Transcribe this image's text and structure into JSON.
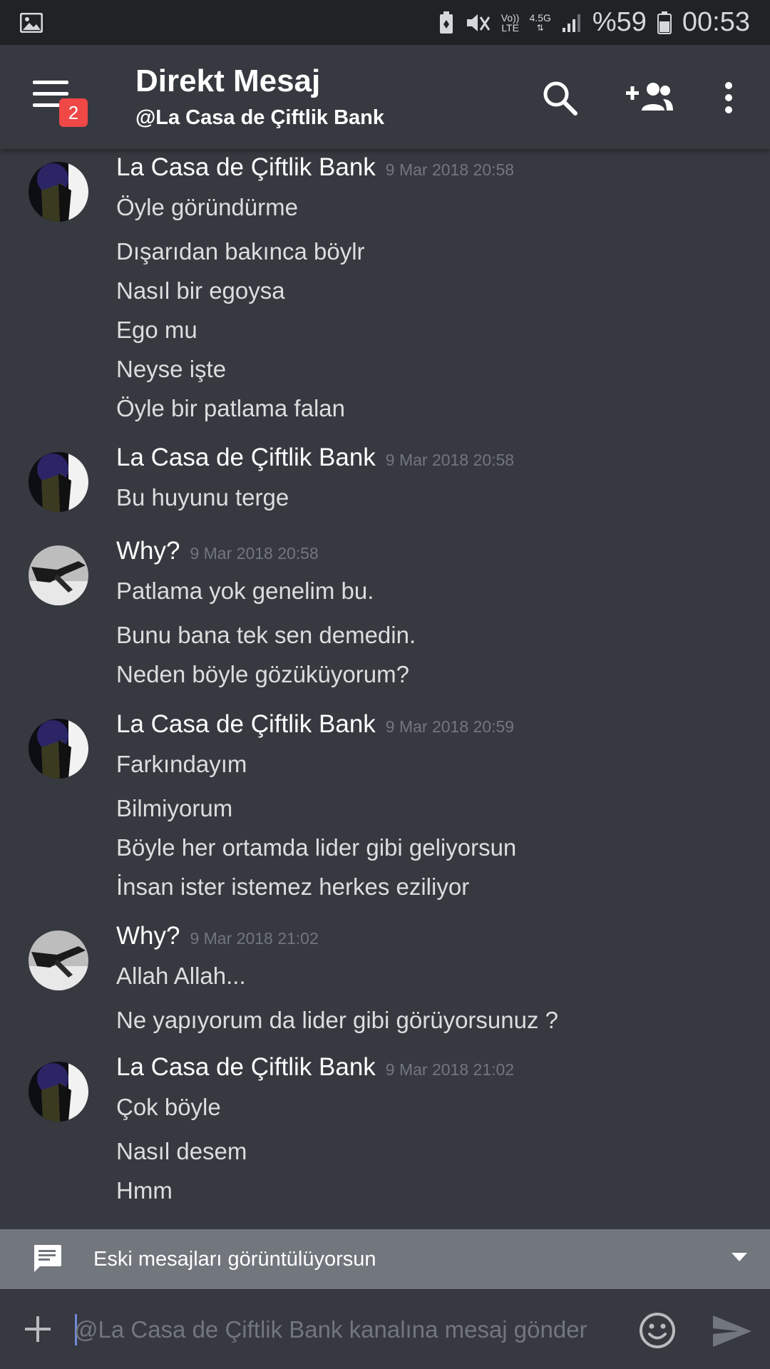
{
  "statusbar": {
    "network_top": "Vo))",
    "network_bottom": "LTE",
    "network_gen": "4.5G",
    "battery": "%59",
    "time": "00:53",
    "icons": [
      "gallery-icon",
      "battery-saver-icon",
      "mute-icon",
      "signal-icon",
      "battery-icon"
    ]
  },
  "header": {
    "title": "Direkt Mesaj",
    "subtitle": "@La Casa de Çiftlik Bank",
    "badge": "2",
    "icons": [
      "hamburger-menu-icon",
      "search-icon",
      "add-friend-icon",
      "more-vertical-icon"
    ]
  },
  "messages": [
    {
      "author": "La Casa de Çiftlik Bank",
      "timestamp": "9 Mar 2018 20:58",
      "avatar": "dark-purple",
      "lines": [
        "Öyle göründürme",
        "Dışarıdan bakınca böylr",
        "Nasıl bir egoysa",
        "Ego mu",
        "Neyse işte",
        "Öyle bir patlama falan"
      ]
    },
    {
      "author": "La Casa de Çiftlik Bank",
      "timestamp": "9 Mar 2018 20:58",
      "avatar": "dark-purple",
      "lines": [
        "Bu huyunu terge"
      ]
    },
    {
      "author": "Why?",
      "timestamp": "9 Mar 2018 20:58",
      "avatar": "grey",
      "lines": [
        "Patlama yok genelim bu.",
        "Bunu bana tek sen demedin.",
        "Neden böyle gözüküyorum?"
      ]
    },
    {
      "author": "La Casa de Çiftlik Bank",
      "timestamp": "9 Mar 2018 20:59",
      "avatar": "dark-purple",
      "lines": [
        "Farkındayım",
        "Bilmiyorum",
        "Böyle her ortamda lider gibi geliyorsun",
        "İnsan ister istemez herkes eziliyor"
      ]
    },
    {
      "author": "Why?",
      "timestamp": "9 Mar 2018 21:02",
      "avatar": "grey",
      "lines": [
        "Allah Allah...",
        "Ne yapıyorum da lider gibi görüyorsunuz ?"
      ]
    },
    {
      "author": "La Casa de Çiftlik Bank",
      "timestamp": "9 Mar 2018 21:02",
      "avatar": "dark-purple",
      "lines": [
        "Çok böyle",
        "Nasıl desem",
        "Hmm"
      ]
    }
  ],
  "notice": {
    "text": "Eski mesajları görüntülüyorsun",
    "icons": [
      "chat-bubble-icon",
      "caret-down-icon"
    ]
  },
  "composer": {
    "placeholder": "@La Casa de Çiftlik Bank kanalına mesaj gönder",
    "value": "",
    "icons": [
      "plus-icon",
      "emoji-icon",
      "send-icon"
    ]
  },
  "colors": {
    "background": "#36393f",
    "statusbar": "#202225",
    "notice": "#72767d",
    "badge": "#f04747",
    "cursor": "#7289da",
    "timestamp": "#72767d",
    "text": "#dcddde"
  }
}
